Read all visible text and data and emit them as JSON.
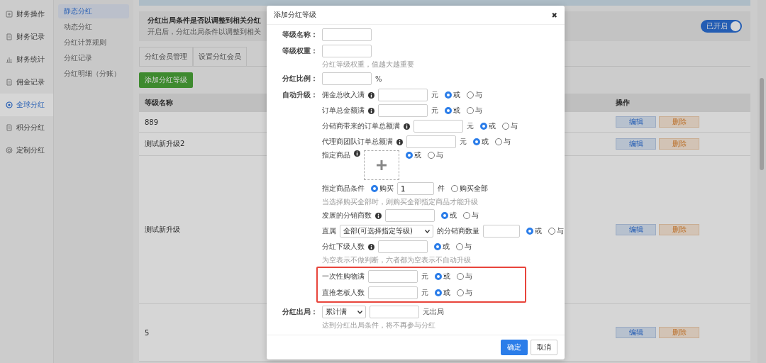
{
  "sidebar": {
    "items": [
      {
        "label": "财务操作",
        "selected": false
      },
      {
        "label": "财务记录",
        "selected": false
      },
      {
        "label": "财务统计",
        "selected": false
      },
      {
        "label": "佣金记录",
        "selected": false
      },
      {
        "label": "全球分红",
        "selected": true
      },
      {
        "label": "积分分红",
        "selected": false
      },
      {
        "label": "定制分红",
        "selected": false
      }
    ]
  },
  "subnav": {
    "items": [
      {
        "label": "静态分红",
        "selected": true
      },
      {
        "label": "动态分红",
        "selected": false
      },
      {
        "label": "分红计算规则",
        "selected": false
      },
      {
        "label": "分红记录",
        "selected": false
      },
      {
        "label": "分红明细（分账）",
        "selected": false
      }
    ]
  },
  "banner": {
    "title": "分红出局条件是否以调整到相关分红",
    "description": "开启后，分红出局条件以调整到相关",
    "toggle": {
      "label": "已开启",
      "on": true
    }
  },
  "tabs": [
    {
      "label": "分红会员管理"
    },
    {
      "label": "设置分红会员"
    }
  ],
  "add_button": "添加分红等级",
  "table": {
    "columns": [
      "等级名称",
      "操作"
    ],
    "rows": [
      {
        "name": "889",
        "actions": [
          "编辑",
          "删除"
        ]
      },
      {
        "name": "测试新升级2",
        "actions": [
          "编辑",
          "删除"
        ]
      },
      {
        "name": "测试新升级",
        "actions": [
          "编辑",
          "删除"
        ]
      },
      {
        "name": "5",
        "actions": [
          "编辑",
          "删除"
        ]
      }
    ]
  },
  "modal": {
    "title": "添加分红等级",
    "close": "✖",
    "fields": [
      {
        "kind": "input",
        "label": "等级名称："
      },
      {
        "kind": "input",
        "label": "等级权重：",
        "hint": "分红等级权重，值越大越重要"
      },
      {
        "kind": "input",
        "label": "分红比例：",
        "suffix": "%"
      },
      {
        "kind": "upgrade",
        "label": "自动升级："
      },
      {
        "kind": "exit",
        "label": "分红出局：",
        "select": "累计满",
        "suffix": "元出局",
        "hint": "达到分红出局条件，将不再参与分红"
      }
    ],
    "upgrade": [
      {
        "kind": "amount",
        "label": "佣金总收入满",
        "info": true,
        "unit": "元",
        "options": [
          {
            "label": "或",
            "selected": true
          },
          {
            "label": "与",
            "selected": false
          }
        ]
      },
      {
        "kind": "amount",
        "label": "订单总金额满",
        "info": true,
        "unit": "元",
        "options": [
          {
            "label": "或",
            "selected": true
          },
          {
            "label": "与",
            "selected": false
          }
        ]
      },
      {
        "kind": "amount",
        "label": "分销商带来的订单总额满",
        "info": true,
        "unit": "元",
        "options": [
          {
            "label": "或",
            "selected": true
          },
          {
            "label": "与",
            "selected": false
          }
        ]
      },
      {
        "kind": "amount",
        "label": "代理商团队订单总额满",
        "info": true,
        "unit": "元",
        "options": [
          {
            "label": "或",
            "selected": true
          },
          {
            "label": "与",
            "selected": false
          }
        ]
      },
      {
        "kind": "product",
        "label": "指定商品",
        "info": true,
        "options": [
          {
            "label": "或",
            "selected": true
          },
          {
            "label": "与",
            "selected": false
          }
        ]
      },
      {
        "kind": "product_condition",
        "label": "指定商品条件",
        "options": [
          {
            "label": "购买",
            "selected": true,
            "value": "1",
            "unit": "件"
          },
          {
            "label": "购买全部",
            "selected": false
          }
        ],
        "hint": "当选择购买全部时，则购买全部指定商品才能升级"
      },
      {
        "kind": "amount",
        "label": "发展的分销商数",
        "info": true,
        "options": [
          {
            "label": "或",
            "selected": true
          },
          {
            "label": "与",
            "selected": false
          }
        ]
      },
      {
        "kind": "direct",
        "label": "直属",
        "select": "全部(可选择指定等级)",
        "after": "的分销商数量",
        "options": [
          {
            "label": "或",
            "selected": true
          },
          {
            "label": "与",
            "selected": false
          }
        ]
      },
      {
        "kind": "amount",
        "label": "分红下级人数",
        "info": true,
        "options": [
          {
            "label": "或",
            "selected": true
          },
          {
            "label": "与",
            "selected": false
          }
        ],
        "hint": "为空表示不做判断，六者都为空表示不自动升级"
      },
      {
        "kind": "highlight",
        "rows": [
          {
            "kind": "amount",
            "label": "一次性购物满",
            "info": false,
            "unit": "元",
            "options": [
              {
                "label": "或",
                "selected": true
              },
              {
                "label": "与",
                "selected": false
              }
            ]
          },
          {
            "kind": "amount",
            "label": "直推老板人数",
            "info": false,
            "unit": "元",
            "options": [
              {
                "label": "或",
                "selected": true
              },
              {
                "label": "与",
                "selected": false
              }
            ]
          }
        ]
      }
    ],
    "buttons": [
      {
        "label": "确定",
        "kind": "primary"
      },
      {
        "label": "取消",
        "kind": "default"
      }
    ]
  }
}
